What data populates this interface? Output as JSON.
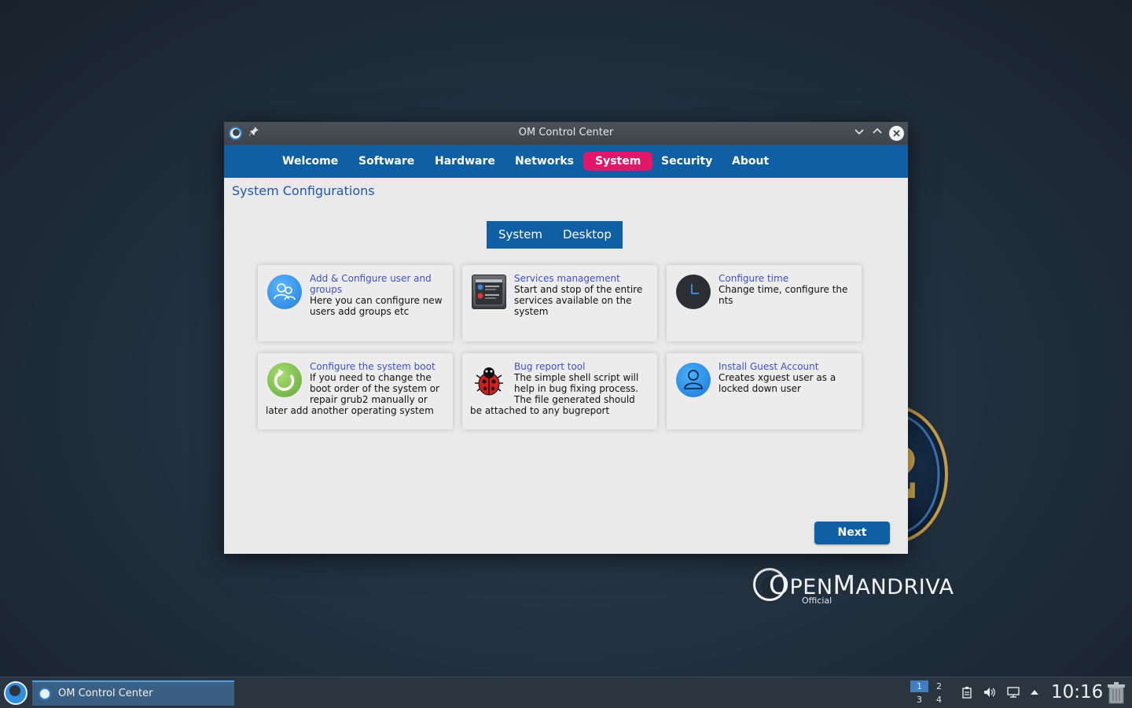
{
  "wallpaper": {
    "emblem_char": "2",
    "logo_text": "OpenMandriva",
    "logo_sub": "Official"
  },
  "window": {
    "title": "OM Control Center",
    "nav_tabs": [
      {
        "label": "Welcome",
        "active": false
      },
      {
        "label": "Software",
        "active": false
      },
      {
        "label": "Hardware",
        "active": false
      },
      {
        "label": "Networks",
        "active": false
      },
      {
        "label": "System",
        "active": true
      },
      {
        "label": "Security",
        "active": false
      },
      {
        "label": "About",
        "active": false
      }
    ],
    "page_title": "System Configurations",
    "segment": {
      "left": "System",
      "right": "Desktop",
      "selected": "System"
    },
    "cards": [
      {
        "title": "Add & Configure user and groups",
        "desc": "Here you can configure new users add groups etc",
        "icon": "users-icon"
      },
      {
        "title": "Services management",
        "desc": "Start and stop of the entire services available on the system",
        "icon": "services-icon"
      },
      {
        "title": "Configure time",
        "desc": "Change time, configure the nts",
        "icon": "clock-icon"
      },
      {
        "title": "Configure the system boot",
        "desc": "If you need to change the boot order of the system or repair grub2 manually or later add another operating system",
        "icon": "refresh-icon"
      },
      {
        "title": "Bug report tool",
        "desc": "The simple shell script will help in bug fixing process. The file generated should be attached to any bugreport",
        "icon": "ladybug-icon"
      },
      {
        "title": "Install Guest Account",
        "desc": "Creates xguest user as a locked down user",
        "icon": "user-icon"
      }
    ],
    "next_label": "Next"
  },
  "taskbar": {
    "task_label": "OM Control Center",
    "pager": [
      "1",
      "2",
      "3",
      "4"
    ],
    "active_desktop": "1",
    "clock": "10:16"
  },
  "colors": {
    "nav_bar": "#0e5fa4",
    "active_tab": "#e2176a",
    "link_title": "#3d52c9",
    "panel": "#2a3540"
  }
}
